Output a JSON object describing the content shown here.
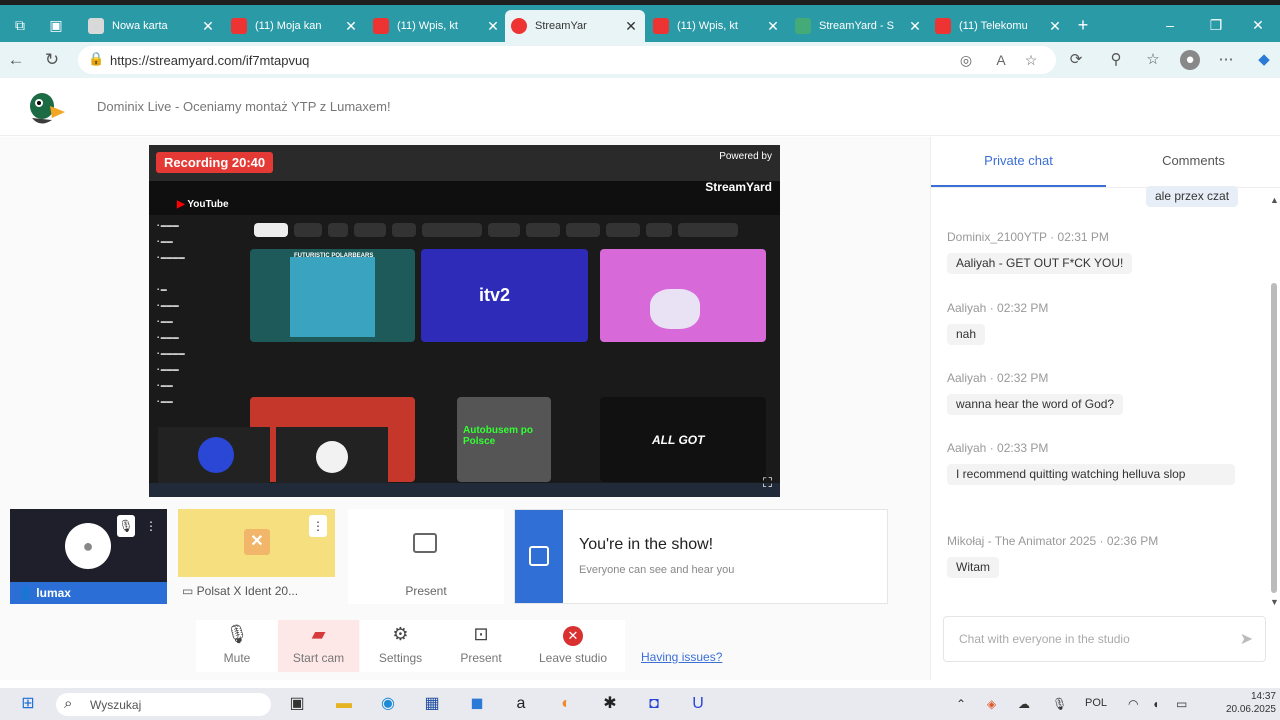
{
  "browser": {
    "tabs": [
      {
        "label": "Nowa karta",
        "icon": "new-tab-icon",
        "color": "#d9d9d9"
      },
      {
        "label": "(11) Moja kan",
        "icon": "youtube-icon",
        "color": "#e33"
      },
      {
        "label": "(11) Wpis, kt",
        "icon": "youtube-icon",
        "color": "#e33"
      },
      {
        "label": "StreamYar",
        "icon": "streamyard-icon",
        "color": "#e33"
      },
      {
        "label": "(11) Wpis, kt",
        "icon": "youtube-icon",
        "color": "#e33"
      },
      {
        "label": "StreamYard - S",
        "icon": "streamyard-icon",
        "color": "#4a7"
      },
      {
        "label": "(11) Telekomu",
        "icon": "youtube-icon",
        "color": "#e33"
      }
    ],
    "url": "https://streamyard.com/if7mtapvuq"
  },
  "header": {
    "title": "Dominix Live - Oceniamy montaż YTP z Lumaxem!"
  },
  "stage": {
    "recording": "Recording 20:40",
    "powered_by": "Powered by",
    "brand": "StreamYard",
    "youtube_label": "YouTube",
    "thumb_texts": [
      "FUTURISTIC POLARBEARS",
      "itv2",
      "ALL GOT",
      "Autobusem po Polsce"
    ]
  },
  "participants": {
    "lumax": "lumax",
    "polsat": "Polsat X Ident 20...",
    "present": "Present",
    "inshow_title": "You're in the show!",
    "inshow_sub": "Everyone can see and hear you"
  },
  "controls": {
    "mute": "Mute",
    "start_cam": "Start cam",
    "settings": "Settings",
    "present": "Present",
    "leave": "Leave studio",
    "issues": "Having issues?"
  },
  "chat": {
    "tab_private": "Private chat",
    "tab_comments": "Comments",
    "top_bubble": "ale przex czat",
    "messages": [
      {
        "author": "Dominix_2100YTP",
        "time": "02:31 PM",
        "text": "Aaliyah - GET OUT F*CK YOU!"
      },
      {
        "author": "Aaliyah",
        "time": "02:32 PM",
        "text": "nah"
      },
      {
        "author": "Aaliyah",
        "time": "02:32 PM",
        "text": "wanna hear the word of God?"
      },
      {
        "author": "Aaliyah",
        "time": "02:33 PM",
        "text": "I recommend quitting watching helluva slop"
      },
      {
        "author": "Mikołaj - The Animator 2025",
        "time": "02:36 PM",
        "text": "Witam"
      }
    ],
    "placeholder": "Chat with everyone in the studio"
  },
  "taskbar": {
    "search_placeholder": "Wyszukaj",
    "lang": "POL",
    "time": "14:37",
    "date": "20.06.2025"
  }
}
